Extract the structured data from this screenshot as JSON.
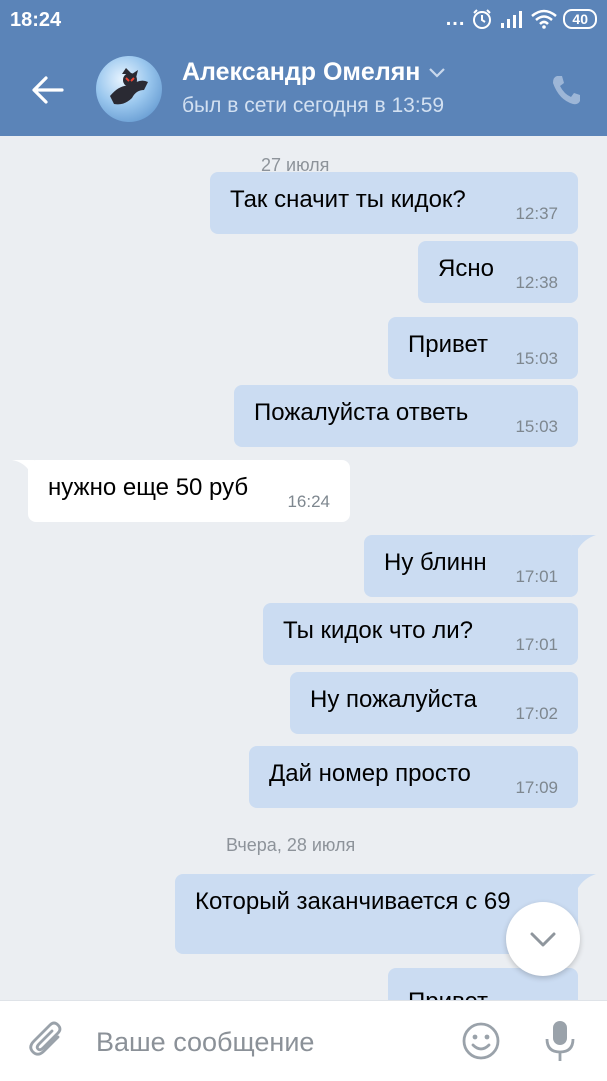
{
  "statusbar": {
    "time": "18:24",
    "dots": "...",
    "battery": "40"
  },
  "header": {
    "name": "Александр Омелян",
    "status": "был в сети сегодня в 13:59"
  },
  "chat": {
    "date1": "27 июля",
    "date2": "Вчера, 28 июля",
    "messages": [
      {
        "text": "Так сначит ты кидок?",
        "time": "12:37"
      },
      {
        "text": "Ясно",
        "time": "12:38"
      },
      {
        "text": "Привет",
        "time": "15:03"
      },
      {
        "text": "Пожалуйста ответь",
        "time": "15:03"
      },
      {
        "text": "нужно еще 50 руб",
        "time": "16:24"
      },
      {
        "text": "Ну блинн",
        "time": "17:01"
      },
      {
        "text": "Ты кидок что ли?",
        "time": "17:01"
      },
      {
        "text": "Ну пожалуйста",
        "time": "17:02"
      },
      {
        "text": "Дай номер просто",
        "time": "17:09"
      },
      {
        "text": "Который заканчивается с 69",
        "time": ""
      },
      {
        "text": "Привет",
        "time": ""
      }
    ]
  },
  "input": {
    "placeholder": "Ваше сообщение"
  },
  "icons": {
    "back": "arrow-left-icon",
    "chevron": "chevron-down-icon",
    "phone": "phone-icon",
    "scroll": "chevron-down-icon",
    "attach": "paperclip-icon",
    "emoji": "smiley-icon",
    "mic": "microphone-icon"
  },
  "colors": {
    "header": "#5b84b8",
    "outgoing": "#cbdcf2",
    "incoming": "#ffffff",
    "background": "#ebeef2"
  }
}
